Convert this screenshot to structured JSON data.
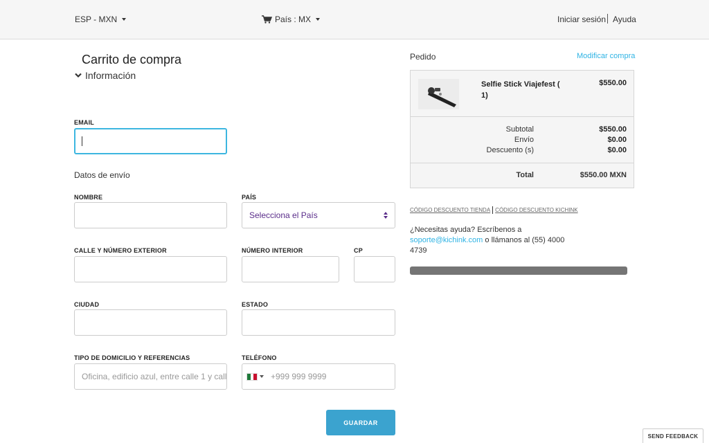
{
  "topbar": {
    "lang_currency": "ESP - MXN",
    "country": "País : MX",
    "login": "Iniciar sesión",
    "help": "Ayuda"
  },
  "left": {
    "title": "Carrito de compra",
    "section": "Información",
    "email_label": "EMAIL",
    "email_value": "",
    "shipping_heading": "Datos de envío",
    "nombre_label": "NOMBRE",
    "pais_label": "PAÍS",
    "pais_value": "Selecciona el País",
    "calle_label": "CALLE Y NÚMERO EXTERIOR",
    "interior_label": "NÚMERO INTERIOR",
    "cp_label": "CP",
    "ciudad_label": "CIUDAD",
    "estado_label": "ESTADO",
    "domicilio_label": "TIPO DE DOMICILIO Y REFERENCIAS",
    "domicilio_placeholder": "Oficina, edificio azul, entre calle 1 y calle 2",
    "telefono_label": "TELÉFONO",
    "telefono_placeholder": "+999 999 9999",
    "save_button": "GUARDAR"
  },
  "order": {
    "title": "Pedido",
    "modify_link": "Modificar compra",
    "product_name": "Selfie Stick Viajefest ( 1)",
    "product_price": "$550.00",
    "subtotal_label": "Subtotal",
    "subtotal_value": "$550.00",
    "envio_label": "Envío",
    "envio_value": "$0.00",
    "descuento_label": "Descuento (s)",
    "descuento_value": "$0.00",
    "total_label": "Total",
    "total_value": "$550.00 MXN"
  },
  "codes": {
    "store_code": "CÓDIGO DESCUENTO TIENDA",
    "kichink_code": "CÓDIGO DESCUENTO KICHINK"
  },
  "help": {
    "prefix": "¿Necesitas ayuda? Escríbenos a",
    "email": "soporte@kichink.com",
    "suffix": "o llámanos al (55) 4000 4739"
  },
  "feedback": "SEND FEEDBACK",
  "colors": {
    "accent": "#2eb3e4",
    "button": "#3ba3cf",
    "select_text": "#5a2d8a",
    "focus_border": "#3cb6e0"
  },
  "icons": [
    "cart-icon",
    "chevron-down-icon",
    "mexico-flag-icon",
    "select-arrows-icon"
  ]
}
